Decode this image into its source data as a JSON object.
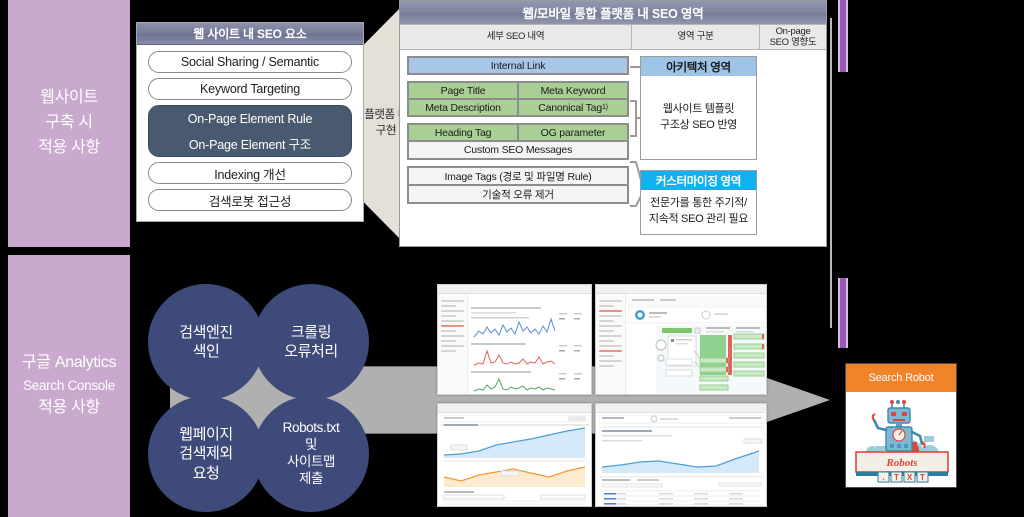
{
  "left_panels": {
    "top": {
      "lines": [
        "웹사이트",
        "구축 시",
        "적용 사항"
      ]
    },
    "bottom": {
      "lines": [
        "구글 Analytics",
        "Search Console",
        "적용 사항"
      ]
    }
  },
  "seo_card": {
    "title": "웹 사이트 내 SEO 요소",
    "items": [
      {
        "label": "Social Sharing / Semantic",
        "style": "light"
      },
      {
        "label": "Keyword Targeting",
        "style": "light"
      },
      {
        "label": "On-Page Element Rule",
        "style": "dark"
      },
      {
        "label": "On-Page Element 구조",
        "style": "dark"
      },
      {
        "label": "Indexing 개선",
        "style": "light"
      },
      {
        "label": "검색로봇 접근성",
        "style": "light"
      }
    ]
  },
  "funnel": {
    "label_line1": "플랫폼 내",
    "label_line2": "구현"
  },
  "platform": {
    "title": "웹/모바일 통합 플랫폼 내 SEO 영역",
    "columns": [
      {
        "label": "세부 SEO 내역"
      },
      {
        "label": "영역 구분"
      },
      {
        "label_line1": "On-page",
        "label_line2": "SEO 영향도"
      }
    ],
    "detail_groups": [
      {
        "rows": [
          [
            {
              "label": "Internal Link",
              "color": "blue"
            }
          ]
        ]
      },
      {
        "rows": [
          [
            {
              "label": "Page Title",
              "color": "green"
            },
            {
              "label": "Meta Keyword",
              "color": "green"
            }
          ],
          [
            {
              "label": "Meta Description",
              "color": "green"
            },
            {
              "label": "Canonical Tag",
              "sup": "1)",
              "color": "green"
            }
          ]
        ]
      },
      {
        "rows": [
          [
            {
              "label": "Heading Tag",
              "color": "green"
            },
            {
              "label": "OG parameter",
              "color": "green"
            }
          ],
          [
            {
              "label": "Custom SEO Messages",
              "color": "white",
              "span": 2
            }
          ]
        ]
      },
      {
        "rows": [
          [
            {
              "label": "Image Tags (경로 및 파일명 Rule)",
              "color": "white",
              "span": 2
            }
          ],
          [
            {
              "label": "기술적 오류 제거",
              "color": "white",
              "span": 2
            }
          ]
        ]
      }
    ],
    "areas": [
      {
        "header": "아키텍처 영역",
        "header_style": "arch",
        "body_line1": "웹사이트 템플릿",
        "body_line2": "구조상 SEO 반영"
      },
      {
        "header": "커스터마이징 영역",
        "header_style": "cust",
        "body_line1": "전문가를 통한 주기적/",
        "body_line2": "지속적 SEO 관리 필요"
      }
    ]
  },
  "circles": [
    {
      "lines": [
        "검색엔진",
        "색인"
      ]
    },
    {
      "lines": [
        "크롤링",
        "오류처리"
      ]
    },
    {
      "lines": [
        "웹페이지",
        "검색제외",
        "요청"
      ]
    },
    {
      "lines": [
        "Robots.txt",
        "및",
        "사이트맵",
        "제출"
      ]
    }
  ],
  "thumbnails": [
    {
      "name": "google-search-console-dashboard"
    },
    {
      "name": "analytics-flow-dashboard"
    },
    {
      "name": "analytics-trend-report"
    },
    {
      "name": "analytics-table-report"
    }
  ],
  "robot_card": {
    "header": "Search Robot",
    "banner_text": "Robots",
    "banner_tiles": [
      ".",
      "T",
      "X",
      "T"
    ]
  },
  "colors": {
    "panel_purple": "#c9a9ce",
    "accent_purple": "#9b59b6",
    "circle_navy": "#3e4a79",
    "arrow_gray": "#b0b0b0",
    "header_slate": "#80859f",
    "pill_dark": "#495a70",
    "cell_blue": "#a8c6e8",
    "cell_green": "#a9cf94",
    "arch_blue": "#9dc3e6",
    "cust_cyan": "#12b0ef",
    "robot_orange": "#f0842a",
    "funnel_beige": "#e3e0d8"
  }
}
